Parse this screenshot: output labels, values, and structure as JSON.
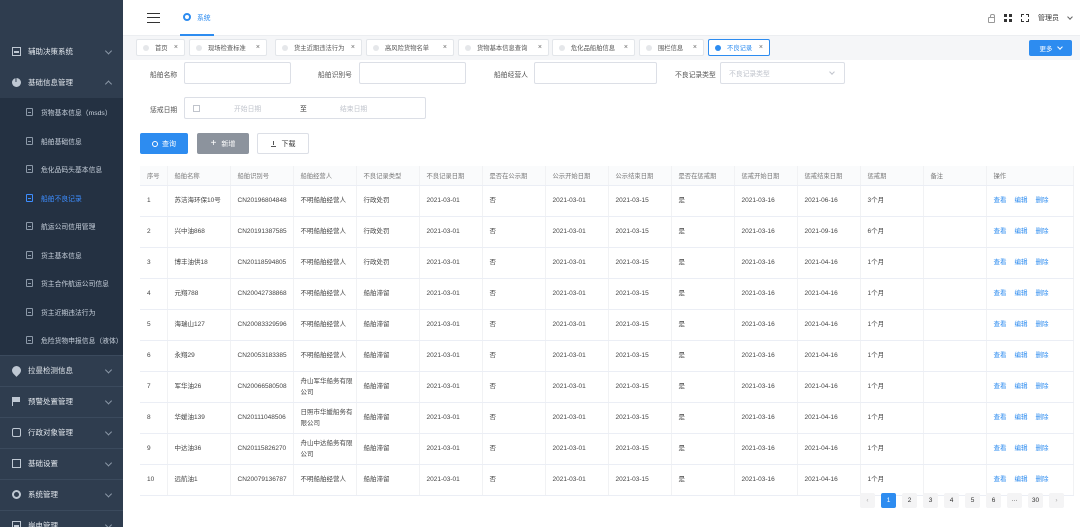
{
  "sidebar": {
    "groups_top": [
      {
        "label": "辅助决策系统",
        "icon": "grid-icon"
      },
      {
        "label": "基础信息管理",
        "icon": "info-icon"
      }
    ],
    "submenu": [
      {
        "label": "货物基本信息（msds）"
      },
      {
        "label": "船舶基础信息"
      },
      {
        "label": "危化品码头基本信息"
      },
      {
        "label": "船舶不良记录",
        "active": true
      },
      {
        "label": "航运公司信用管理"
      },
      {
        "label": "货主基本信息"
      },
      {
        "label": "货主合作航运公司信息"
      },
      {
        "label": "货主近期违法行为"
      },
      {
        "label": "危险货物申报信息（液体）"
      }
    ],
    "groups_bottom": [
      {
        "label": "拉曼检测信息",
        "icon": "drop-icon"
      },
      {
        "label": "预警处置管理",
        "icon": "flag-icon"
      },
      {
        "label": "行政对象管理",
        "icon": "chat-icon"
      },
      {
        "label": "基础设置",
        "icon": "monitor-icon"
      },
      {
        "label": "系统管理",
        "icon": "gear-icon"
      },
      {
        "label": "岸电管理",
        "icon": "grid-icon"
      }
    ]
  },
  "header": {
    "system_tab": "系统",
    "user": "管理员"
  },
  "tags": [
    {
      "label": "首页"
    },
    {
      "label": "现场检查标准"
    },
    {
      "label": "货主近期违法行为"
    },
    {
      "label": "高风险货物名单"
    },
    {
      "label": "货物基本信息查询"
    },
    {
      "label": "危化品船舶信息"
    },
    {
      "label": "围栏信息"
    },
    {
      "label": "不良记录",
      "active": true
    }
  ],
  "more_label": "更多",
  "filters": {
    "ship_name_label": "船舶名称",
    "ship_id_label": "船舶识别号",
    "operator_label": "船舶经营人",
    "record_type_label": "不良记录类型",
    "record_type_placeholder": "不良记录类型",
    "period_label": "惩戒日期",
    "start_placeholder": "开始日期",
    "to_label": "至",
    "end_placeholder": "结束日期"
  },
  "buttons": {
    "search": "查询",
    "add": "新增",
    "download": "下载"
  },
  "table": {
    "columns": [
      "序号",
      "船舶名称",
      "船舶识别号",
      "船舶经营人",
      "不良记录类型",
      "不良记录日期",
      "是否在公示期",
      "公示开始日期",
      "公示结束日期",
      "是否在惩戒期",
      "惩戒开始日期",
      "惩戒结束日期",
      "惩戒期",
      "备注",
      "操作"
    ],
    "rows": [
      [
        "1",
        "苏洁海环保10号",
        "CN20196804848",
        "不明船舶经营人",
        "行政处罚",
        "2021-03-01",
        "否",
        "2021-03-01",
        "2021-03-15",
        "是",
        "2021-03-16",
        "2021-06-16",
        "3个月",
        ""
      ],
      [
        "2",
        "兴中油868",
        "CN20191387585",
        "不明船舶经营人",
        "行政处罚",
        "2021-03-01",
        "否",
        "2021-03-01",
        "2021-03-15",
        "是",
        "2021-03-16",
        "2021-09-16",
        "6个月",
        ""
      ],
      [
        "3",
        "博丰油供18",
        "CN20118594805",
        "不明船舶经营人",
        "行政处罚",
        "2021-03-01",
        "否",
        "2021-03-01",
        "2021-03-15",
        "是",
        "2021-03-16",
        "2021-04-16",
        "1个月",
        ""
      ],
      [
        "4",
        "元翔788",
        "CN20042738868",
        "不明船舶经营人",
        "船舶滞留",
        "2021-03-01",
        "否",
        "2021-03-01",
        "2021-03-15",
        "是",
        "2021-03-16",
        "2021-04-16",
        "1个月",
        ""
      ],
      [
        "5",
        "海瑞山127",
        "CN20083329596",
        "不明船舶经营人",
        "船舶滞留",
        "2021-03-01",
        "否",
        "2021-03-01",
        "2021-03-15",
        "是",
        "2021-03-16",
        "2021-04-16",
        "1个月",
        ""
      ],
      [
        "6",
        "永翔29",
        "CN20053183385",
        "不明船舶经营人",
        "船舶滞留",
        "2021-03-01",
        "否",
        "2021-03-01",
        "2021-03-15",
        "是",
        "2021-03-16",
        "2021-04-16",
        "1个月",
        ""
      ],
      [
        "7",
        "军华油26",
        "CN20066580508",
        "舟山军华船务有限公司",
        "船舶滞留",
        "2021-03-01",
        "否",
        "2021-03-01",
        "2021-03-15",
        "是",
        "2021-03-16",
        "2021-04-16",
        "1个月",
        ""
      ],
      [
        "8",
        "华媛油139",
        "CN20111048506",
        "日照市华媛船务有限公司",
        "船舶滞留",
        "2021-03-01",
        "否",
        "2021-03-01",
        "2021-03-15",
        "是",
        "2021-03-16",
        "2021-04-16",
        "1个月",
        ""
      ],
      [
        "9",
        "中达油36",
        "CN20115826270",
        "舟山中达船务有限公司",
        "船舶滞留",
        "2021-03-01",
        "否",
        "2021-03-01",
        "2021-03-15",
        "是",
        "2021-03-16",
        "2021-04-16",
        "1个月",
        ""
      ],
      [
        "10",
        "远航油1",
        "CN20079136787",
        "不明船舶经营人",
        "船舶滞留",
        "2021-03-01",
        "否",
        "2021-03-01",
        "2021-03-15",
        "是",
        "2021-03-16",
        "2021-04-16",
        "1个月",
        ""
      ]
    ],
    "actions": [
      "查看",
      "编辑",
      "删除"
    ]
  },
  "pager": {
    "pages": [
      "1",
      "2",
      "3",
      "4",
      "5",
      "6",
      "···",
      "30"
    ],
    "prev": "‹",
    "next": "›",
    "current": "1"
  }
}
